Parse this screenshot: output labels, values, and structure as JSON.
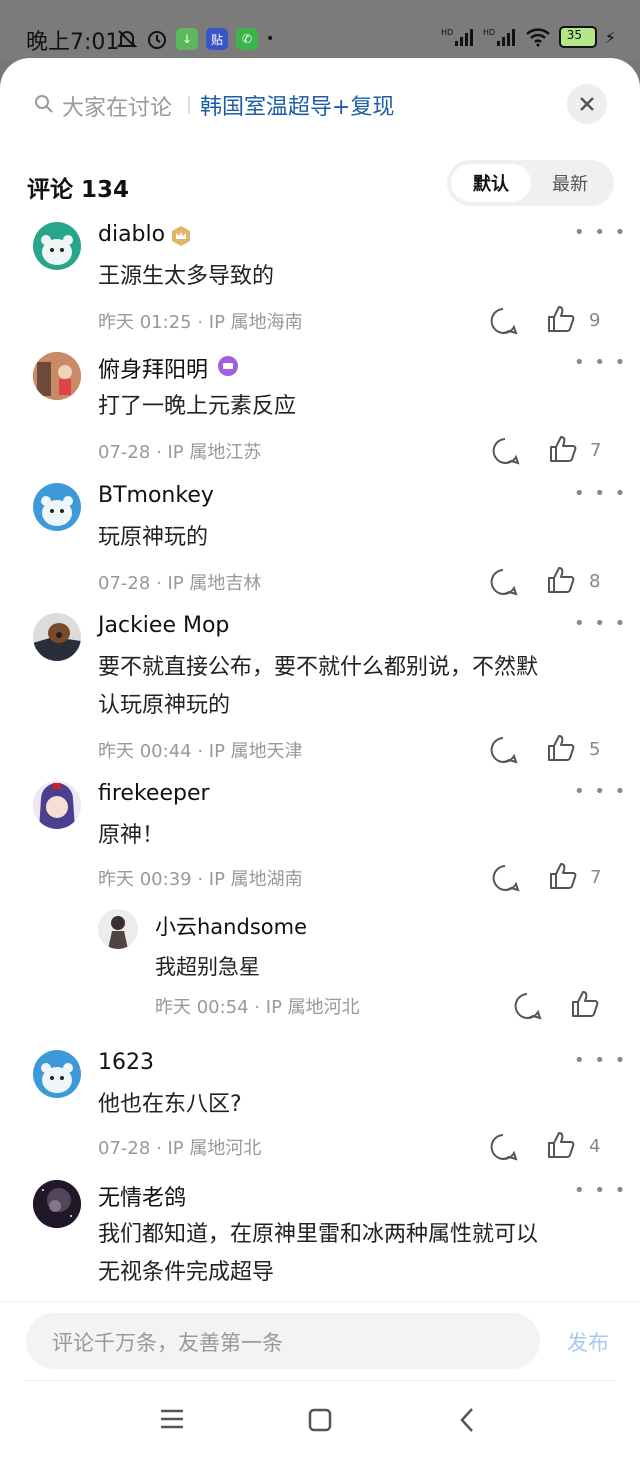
{
  "status_bar": {
    "time": "晚上7:01",
    "battery": "35",
    "app_icon_label": "贴",
    "icons": [
      "mute-icon",
      "alarm-icon",
      "download-app-icon",
      "tieba-app-icon",
      "phone-app-icon",
      "dot-icon",
      "hd-signal-icon",
      "hd-signal-icon",
      "wifi-icon",
      "battery-icon",
      "charging-icon"
    ]
  },
  "header": {
    "search_hint": "大家在讨论",
    "topic": "韩国室温超导+复现",
    "comment_count": "评论 134",
    "sort_options": [
      "默认",
      "最新"
    ],
    "active_sort": "默认"
  },
  "comments": [
    {
      "user": "diablo",
      "text": "王源生太多导致的",
      "time": "昨天 01:25 · IP 属地海南",
      "likes": "9",
      "badge": "crown-badge-icon"
    },
    {
      "user": "俯身拜阳明",
      "text": "打了一晚上元素反应",
      "time": "07-28 · IP 属地江苏",
      "likes": "7",
      "badge": "level-badge-icon"
    },
    {
      "user": "BTmonkey",
      "text": "玩原神玩的",
      "time": "07-28 · IP 属地吉林",
      "likes": "8"
    },
    {
      "user": "Jackiee Mop",
      "text_line1": "要不就直接公布，要不就什么都别说，不然默",
      "text_line2": "认玩原神玩的",
      "time": "昨天 00:44 · IP 属地天津",
      "likes": "5"
    },
    {
      "user": "firekeeper",
      "text": "原神！",
      "time": "昨天 00:39 · IP 属地湖南",
      "likes": "7",
      "reply": {
        "user": "小云handsome",
        "text": "我超别急星",
        "time": "昨天 00:54 · IP 属地河北"
      }
    },
    {
      "user": "1623",
      "text": "他也在东八区?",
      "time": "07-28 · IP 属地河北",
      "likes": "4"
    },
    {
      "user": "无情老鸽",
      "text_line1": "我们都知道，在原神里雷和冰两种属性就可以",
      "text_line2": "无视条件完成超导"
    }
  ],
  "input_bar": {
    "placeholder": "评论千万条，友善第一条",
    "publish_label": "发布"
  },
  "colors": {
    "accent_blue": "#1c5ea8",
    "publish_disabled": "#a9c7ef"
  }
}
